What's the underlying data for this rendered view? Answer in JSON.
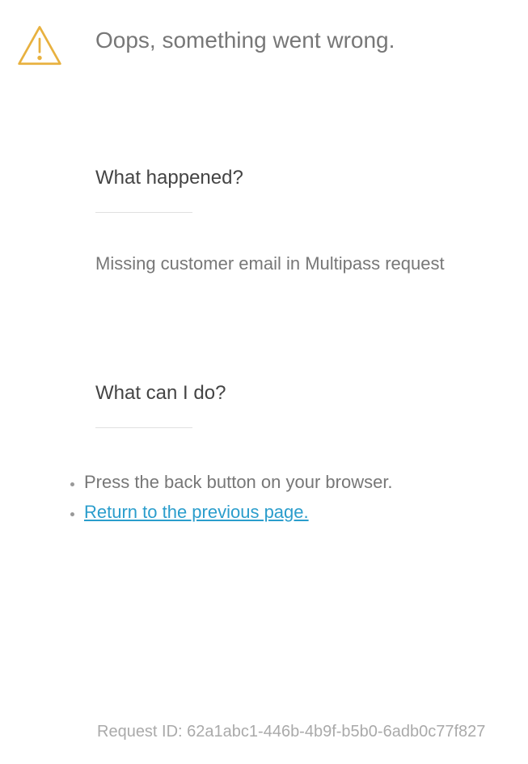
{
  "header": {
    "title": "Oops, something went wrong."
  },
  "sections": {
    "whatHappened": {
      "heading": "What happened?",
      "message": "Missing customer email in Multipass request"
    },
    "whatCanIDo": {
      "heading": "What can I do?",
      "steps": {
        "step1": "Press the back button on your browser.",
        "step2": "Return to the previous page."
      }
    }
  },
  "footer": {
    "requestIdLabel": "Request ID: ",
    "requestId": "62a1abc1-446b-4b9f-b5b0-6adb0c77f827"
  }
}
